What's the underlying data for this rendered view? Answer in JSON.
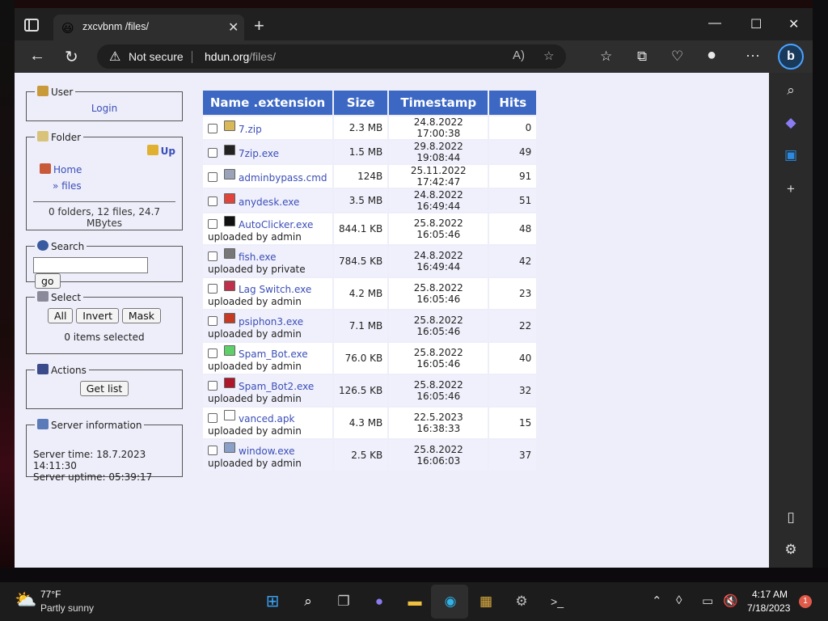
{
  "browser": {
    "tab_title": "zxcvbnm /files/",
    "not_secure": "Not secure",
    "url_host": "hdun.org",
    "url_path": "/files/"
  },
  "user": {
    "legend": "User",
    "login": "Login"
  },
  "folder": {
    "legend": "Folder",
    "up": "Up",
    "home": "Home",
    "current": "» files",
    "summary": "0 folders, 12 files, 24.7 MBytes"
  },
  "search": {
    "legend": "Search",
    "value": "",
    "go": "go"
  },
  "select": {
    "legend": "Select",
    "all": "All",
    "invert": "Invert",
    "mask": "Mask",
    "status": "0 items selected"
  },
  "actions": {
    "legend": "Actions",
    "get_list": "Get list"
  },
  "server": {
    "legend": "Server information",
    "time": "Server time: 18.7.2023 14:11:30",
    "uptime": "Server uptime: 05:39:17"
  },
  "table": {
    "headers": [
      "Name .extension",
      "Size",
      "Timestamp",
      "Hits"
    ],
    "rows": [
      {
        "name": "7.zip",
        "uploader": "",
        "size": "2.3 MB",
        "timestamp": "24.8.2022 17:00:38",
        "hits": "0",
        "icon": "zip-icon",
        "color": "#d9b85a"
      },
      {
        "name": "7zip.exe",
        "uploader": "",
        "size": "1.5 MB",
        "timestamp": "29.8.2022 19:08:44",
        "hits": "49",
        "icon": "7zip-icon",
        "color": "#222222"
      },
      {
        "name": "adminbypass.cmd",
        "uploader": "",
        "size": "124B",
        "timestamp": "25.11.2022 17:42:47",
        "hits": "91",
        "icon": "cmd-icon",
        "color": "#9aa3b8"
      },
      {
        "name": "anydesk.exe",
        "uploader": "",
        "size": "3.5 MB",
        "timestamp": "24.8.2022 16:49:44",
        "hits": "51",
        "icon": "anydesk-icon",
        "color": "#e0443a"
      },
      {
        "name": "AutoClicker.exe",
        "uploader": "uploaded by admin",
        "size": "844.1 KB",
        "timestamp": "25.8.2022 16:05:46",
        "hits": "48",
        "icon": "autoclicker-icon",
        "color": "#111111"
      },
      {
        "name": "fish.exe",
        "uploader": "uploaded by private",
        "size": "784.5 KB",
        "timestamp": "24.8.2022 16:49:44",
        "hits": "42",
        "icon": "fish-icon",
        "color": "#777777"
      },
      {
        "name": "Lag Switch.exe",
        "uploader": "uploaded by admin",
        "size": "4.2 MB",
        "timestamp": "25.8.2022 16:05:46",
        "hits": "23",
        "icon": "lagswitch-icon",
        "color": "#c0304a"
      },
      {
        "name": "psiphon3.exe",
        "uploader": "uploaded by admin",
        "size": "7.1 MB",
        "timestamp": "25.8.2022 16:05:46",
        "hits": "22",
        "icon": "psiphon-icon",
        "color": "#c63a24"
      },
      {
        "name": "Spam_Bot.exe",
        "uploader": "uploaded by admin",
        "size": "76.0 KB",
        "timestamp": "25.8.2022 16:05:46",
        "hits": "40",
        "icon": "spambot-icon",
        "color": "#5fcf6a"
      },
      {
        "name": "Spam_Bot2.exe",
        "uploader": "uploaded by admin",
        "size": "126.5 KB",
        "timestamp": "25.8.2022 16:05:46",
        "hits": "32",
        "icon": "spambot2-icon",
        "color": "#b0162a"
      },
      {
        "name": "vanced.apk",
        "uploader": "uploaded by admin",
        "size": "4.3 MB",
        "timestamp": "22.5.2023 16:38:33",
        "hits": "15",
        "icon": "file-icon",
        "color": "#ffffff"
      },
      {
        "name": "window.exe",
        "uploader": "uploaded by admin",
        "size": "2.5 KB",
        "timestamp": "25.8.2022 16:06:03",
        "hits": "37",
        "icon": "window-icon",
        "color": "#8aa0c8"
      }
    ]
  },
  "taskbar": {
    "temp": "77°F",
    "weather": "Partly sunny",
    "time": "4:17 AM",
    "date": "7/18/2023",
    "notifications": "1"
  },
  "colors": {
    "header_bg": "#3c68c4",
    "link": "#3a4eb8",
    "page_bg": "#eeeefa"
  }
}
